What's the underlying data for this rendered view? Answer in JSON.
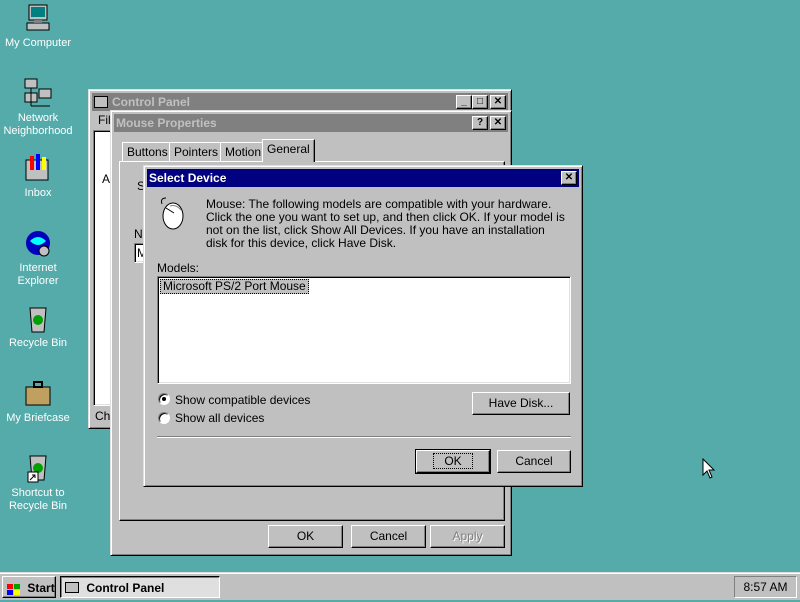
{
  "desktop": {
    "icons": [
      {
        "label": "My Computer",
        "icon": "computer-icon"
      },
      {
        "label": "Network Neighborhood",
        "icon": "network-icon"
      },
      {
        "label": "Inbox",
        "icon": "inbox-icon"
      },
      {
        "label": "Internet Explorer",
        "icon": "internet-explorer-icon"
      },
      {
        "label": "Recycle Bin",
        "icon": "recycle-bin-icon"
      },
      {
        "label": "My Briefcase",
        "icon": "briefcase-icon"
      },
      {
        "label": "Shortcut to Recycle Bin",
        "icon": "recycle-bin-shortcut-icon"
      }
    ]
  },
  "control_panel": {
    "title": "Control Panel",
    "menu_fragment": "File",
    "side_letter": "A",
    "status_fragment": "Cha"
  },
  "mouse_props": {
    "title": "Mouse Properties",
    "tabs": [
      "Buttons",
      "Pointers",
      "Motion",
      "General"
    ],
    "active_tab": "General",
    "fragment_s": "S",
    "fragment_n": "N",
    "fragment_m": "M",
    "ok": "OK",
    "cancel": "Cancel",
    "apply": "Apply"
  },
  "select_device": {
    "title": "Select Device",
    "description": "Mouse: The following models are compatible with your hardware. Click the one you want to set up, and then click OK. If your model is not on the list, click Show All Devices. If you have an installation disk for this device, click Have Disk.",
    "models_label": "Models:",
    "models": [
      "Microsoft PS/2 Port Mouse"
    ],
    "show_compatible": "Show compatible devices",
    "show_all": "Show all devices",
    "selected_option": "show_compatible",
    "have_disk": "Have Disk...",
    "ok": "OK",
    "cancel": "Cancel"
  },
  "taskbar": {
    "start": "Start",
    "task": "Control Panel",
    "clock": "8:57 AM"
  },
  "colors": {
    "desktop": "#55aaaa",
    "title_active": "#000080",
    "title_inactive": "#808080",
    "face": "#c0c0c0"
  }
}
